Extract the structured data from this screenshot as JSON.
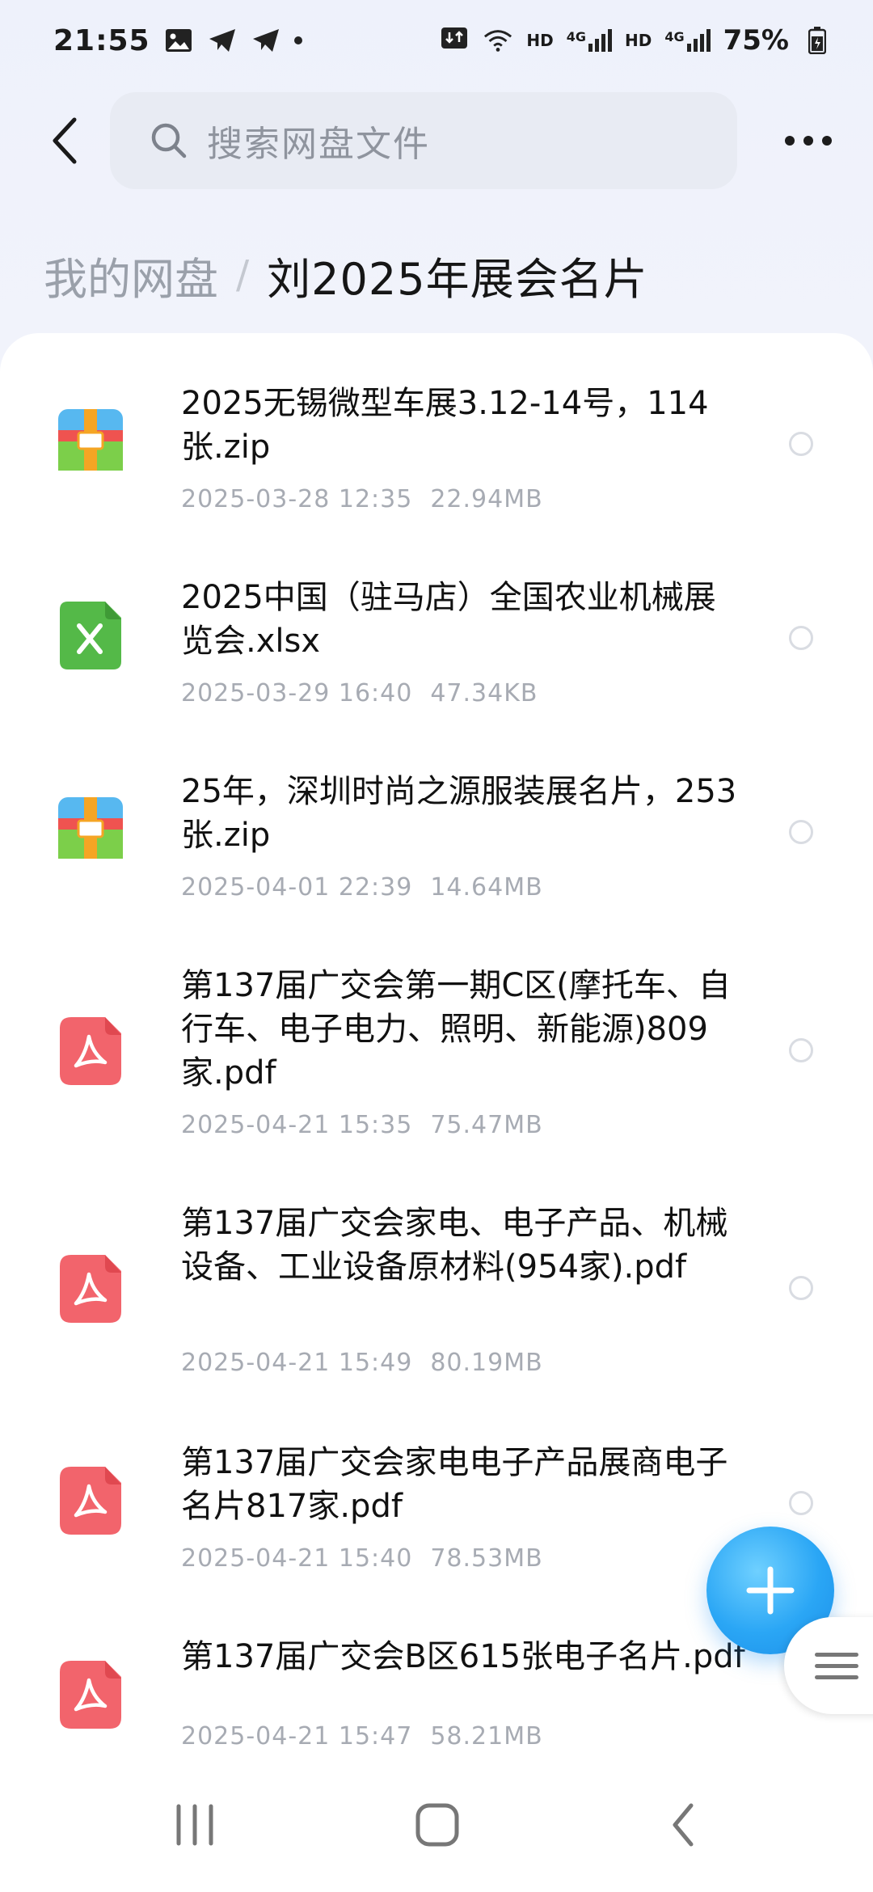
{
  "status_bar": {
    "time": "21:55",
    "net_hd_1": "HD",
    "net_4g_1": "4G",
    "net_hd_2": "HD",
    "net_4g_2": "4G",
    "battery": "75%"
  },
  "search": {
    "placeholder": "搜索网盘文件"
  },
  "breadcrumb": {
    "root": "我的网盘",
    "separator": "/",
    "current": "刘2025年展会名片"
  },
  "files": [
    {
      "name": "2025无锡微型车展3.12-14号，114张.zip",
      "date": "2025-03-28 12:35",
      "size": "22.94MB",
      "type": "zip"
    },
    {
      "name": "2025中国（驻马店）全国农业机械展览会.xlsx",
      "date": "2025-03-29 16:40",
      "size": "47.34KB",
      "type": "xlsx"
    },
    {
      "name": "25年，深圳时尚之源服装展名片，253张.zip",
      "date": "2025-04-01 22:39",
      "size": "14.64MB",
      "type": "zip"
    },
    {
      "name": "第137届广交会第一期C区(摩托车、自行车、电子电力、照明、新能源)809家.pdf",
      "date": "2025-04-21 15:35",
      "size": "75.47MB",
      "type": "pdf"
    },
    {
      "name": "第137届广交会家电、电子产品、机械设备、工业设备原材料(954家).pdf",
      "date": "2025-04-21 15:49",
      "size": "80.19MB",
      "type": "pdf"
    },
    {
      "name": "第137届广交会家电电子产品展商电子名片817家.pdf",
      "date": "2025-04-21 15:40",
      "size": "78.53MB",
      "type": "pdf"
    },
    {
      "name": "第137届广交会B区615张电子名片.pdf",
      "date": "2025-04-21 15:47",
      "size": "58.21MB",
      "type": "pdf"
    }
  ],
  "icons": {
    "zip": "archive-icon",
    "xlsx": "excel-icon",
    "pdf": "pdf-icon"
  },
  "colors": {
    "accent": "#2aa6f5",
    "pdf": "#f2646c",
    "excel": "#54b948"
  }
}
